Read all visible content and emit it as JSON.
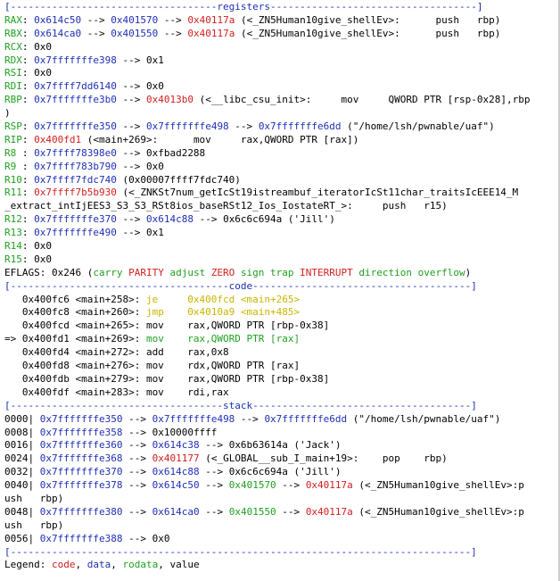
{
  "colors": {
    "code": "#1fa01f",
    "data": "#1f2fb4",
    "rodata": "#c8b400",
    "value": "#d21e1e",
    "text": "#000000"
  },
  "lines": [
    {
      "kind": "separator",
      "segs": [
        [
          "b",
          "[-----------------------------------"
        ],
        [
          "b",
          "registers"
        ],
        [
          "b",
          "-----------------------------------]"
        ]
      ]
    },
    {
      "kind": "register",
      "segs": [
        [
          "g",
          "RAX"
        ],
        [
          "k",
          ": "
        ],
        [
          "b",
          "0x614c50"
        ],
        [
          "k",
          " --> "
        ],
        [
          "b",
          "0x401570"
        ],
        [
          "k",
          " --> "
        ],
        [
          "r",
          "0x40117a"
        ],
        [
          "k",
          " (<_ZN5Human10give_shellEv>:      push   rbp)"
        ]
      ]
    },
    {
      "kind": "register",
      "segs": [
        [
          "g",
          "RBX"
        ],
        [
          "k",
          ": "
        ],
        [
          "b",
          "0x614ca0"
        ],
        [
          "k",
          " --> "
        ],
        [
          "b",
          "0x401550"
        ],
        [
          "k",
          " --> "
        ],
        [
          "r",
          "0x40117a"
        ],
        [
          "k",
          " (<_ZN5Human10give_shellEv>:      push   rbp)"
        ]
      ]
    },
    {
      "kind": "register",
      "segs": [
        [
          "g",
          "RCX"
        ],
        [
          "k",
          ": 0x0"
        ]
      ]
    },
    {
      "kind": "register",
      "segs": [
        [
          "g",
          "RDX"
        ],
        [
          "k",
          ": "
        ],
        [
          "b",
          "0x7fffffffe398"
        ],
        [
          "k",
          " --> 0x1"
        ]
      ]
    },
    {
      "kind": "register",
      "segs": [
        [
          "g",
          "RSI"
        ],
        [
          "k",
          ": 0x0"
        ]
      ]
    },
    {
      "kind": "register",
      "segs": [
        [
          "g",
          "RDI"
        ],
        [
          "k",
          ": "
        ],
        [
          "b",
          "0x7ffff7dd6140"
        ],
        [
          "k",
          " --> 0x0"
        ]
      ]
    },
    {
      "kind": "register",
      "segs": [
        [
          "g",
          "RBP"
        ],
        [
          "k",
          ": "
        ],
        [
          "b",
          "0x7fffffffe3b0"
        ],
        [
          "k",
          " --> "
        ],
        [
          "r",
          "0x4013b0"
        ],
        [
          "k",
          " (<__libc_csu_init>:     mov     QWORD PTR [rsp-0x28],rbp"
        ]
      ]
    },
    {
      "kind": "register",
      "segs": [
        [
          "k",
          ")"
        ]
      ]
    },
    {
      "kind": "register",
      "segs": [
        [
          "g",
          "RSP"
        ],
        [
          "k",
          ": "
        ],
        [
          "b",
          "0x7fffffffe350"
        ],
        [
          "k",
          " --> "
        ],
        [
          "b",
          "0x7fffffffe498"
        ],
        [
          "k",
          " --> "
        ],
        [
          "b",
          "0x7fffffffe6dd"
        ],
        [
          "k",
          " (\"/home/lsh/pwnable/uaf\")"
        ]
      ]
    },
    {
      "kind": "register",
      "segs": [
        [
          "g",
          "RIP"
        ],
        [
          "k",
          ": "
        ],
        [
          "r",
          "0x400fd1"
        ],
        [
          "k",
          " (<main+269>:      mov     rax,QWORD PTR [rax])"
        ]
      ]
    },
    {
      "kind": "register",
      "segs": [
        [
          "g",
          "R8 "
        ],
        [
          "k",
          ": "
        ],
        [
          "b",
          "0x7ffff78398e0"
        ],
        [
          "k",
          " --> 0xfbad2288"
        ]
      ]
    },
    {
      "kind": "register",
      "segs": [
        [
          "g",
          "R9 "
        ],
        [
          "k",
          ": "
        ],
        [
          "b",
          "0x7ffff783b790"
        ],
        [
          "k",
          " --> 0x0"
        ]
      ]
    },
    {
      "kind": "register",
      "segs": [
        [
          "g",
          "R10"
        ],
        [
          "k",
          ": "
        ],
        [
          "b",
          "0x7ffff7fdc740"
        ],
        [
          "k",
          " (0x00007ffff7fdc740)"
        ]
      ]
    },
    {
      "kind": "register",
      "segs": [
        [
          "g",
          "R11"
        ],
        [
          "k",
          ": "
        ],
        [
          "r",
          "0x7ffff7b5b930"
        ],
        [
          "k",
          " (<_ZNKSt7num_getIcSt19istreambuf_iteratorIcSt11char_traitsIcEEE14_M"
        ]
      ]
    },
    {
      "kind": "register",
      "segs": [
        [
          "k",
          "_extract_intIjEES3_S3_S3_RSt8ios_baseRSt12_Ios_IostateRT_>:     push   r15)"
        ]
      ]
    },
    {
      "kind": "register",
      "segs": [
        [
          "g",
          "R12"
        ],
        [
          "k",
          ": "
        ],
        [
          "b",
          "0x7fffffffe370"
        ],
        [
          "k",
          " --> "
        ],
        [
          "b",
          "0x614c88"
        ],
        [
          "k",
          " --> 0x6c6c694a ('Jill')"
        ]
      ]
    },
    {
      "kind": "register",
      "segs": [
        [
          "g",
          "R13"
        ],
        [
          "k",
          ": "
        ],
        [
          "b",
          "0x7fffffffe490"
        ],
        [
          "k",
          " --> 0x1"
        ]
      ]
    },
    {
      "kind": "register",
      "segs": [
        [
          "g",
          "R14"
        ],
        [
          "k",
          ": 0x0"
        ]
      ]
    },
    {
      "kind": "register",
      "segs": [
        [
          "g",
          "R15"
        ],
        [
          "k",
          ": 0x0"
        ]
      ]
    },
    {
      "kind": "flags",
      "segs": [
        [
          "k",
          "EFLAGS: 0x246 ("
        ],
        [
          "g",
          "carry "
        ],
        [
          "r",
          "PARITY "
        ],
        [
          "g",
          "adjust "
        ],
        [
          "r",
          "ZERO "
        ],
        [
          "g",
          "sign trap "
        ],
        [
          "r",
          "INTERRUPT "
        ],
        [
          "g",
          "direction overflow"
        ],
        [
          "k",
          ")"
        ]
      ]
    },
    {
      "kind": "separator",
      "segs": [
        [
          "b",
          "[-------------------------------------"
        ],
        [
          "b",
          "code"
        ],
        [
          "b",
          "-------------------------------------]"
        ]
      ]
    },
    {
      "kind": "code",
      "segs": [
        [
          "k",
          "   0x400fc6 <main+258>: "
        ],
        [
          "y",
          "je     0x400fcd <main+265>"
        ]
      ]
    },
    {
      "kind": "code",
      "segs": [
        [
          "k",
          "   0x400fc8 <main+260>: "
        ],
        [
          "y",
          "jmp    0x4010a9 <main+485>"
        ]
      ]
    },
    {
      "kind": "code",
      "segs": [
        [
          "k",
          "   0x400fcd <main+265>: mov    rax,QWORD PTR [rbp-0x38]"
        ]
      ]
    },
    {
      "kind": "code",
      "segs": [
        [
          "k",
          "=> 0x400fd1 <main+269>: "
        ],
        [
          "g",
          "mov    rax,QWORD PTR [rax]"
        ]
      ]
    },
    {
      "kind": "code",
      "segs": [
        [
          "k",
          "   0x400fd4 <main+272>: add    rax,0x8"
        ]
      ]
    },
    {
      "kind": "code",
      "segs": [
        [
          "k",
          "   0x400fd8 <main+276>: mov    rdx,QWORD PTR [rax]"
        ]
      ]
    },
    {
      "kind": "code",
      "segs": [
        [
          "k",
          "   0x400fdb <main+279>: mov    rax,QWORD PTR [rbp-0x38]"
        ]
      ]
    },
    {
      "kind": "code",
      "segs": [
        [
          "k",
          "   0x400fdf <main+283>: mov    rdi,rax"
        ]
      ]
    },
    {
      "kind": "separator",
      "segs": [
        [
          "b",
          "[------------------------------------"
        ],
        [
          "b",
          "stack"
        ],
        [
          "b",
          "-------------------------------------]"
        ]
      ]
    },
    {
      "kind": "stack",
      "segs": [
        [
          "k",
          "0000| "
        ],
        [
          "b",
          "0x7fffffffe350"
        ],
        [
          "k",
          " --> "
        ],
        [
          "b",
          "0x7fffffffe498"
        ],
        [
          "k",
          " --> "
        ],
        [
          "b",
          "0x7fffffffe6dd"
        ],
        [
          "k",
          " (\"/home/lsh/pwnable/uaf\")"
        ]
      ]
    },
    {
      "kind": "stack",
      "segs": [
        [
          "k",
          "0008| "
        ],
        [
          "b",
          "0x7fffffffe358"
        ],
        [
          "k",
          " --> 0x10000ffff"
        ]
      ]
    },
    {
      "kind": "stack",
      "segs": [
        [
          "k",
          "0016| "
        ],
        [
          "b",
          "0x7fffffffe360"
        ],
        [
          "k",
          " --> "
        ],
        [
          "b",
          "0x614c38"
        ],
        [
          "k",
          " --> 0x6b63614a ('Jack')"
        ]
      ]
    },
    {
      "kind": "stack",
      "segs": [
        [
          "k",
          "0024| "
        ],
        [
          "b",
          "0x7fffffffe368"
        ],
        [
          "k",
          " --> "
        ],
        [
          "r",
          "0x401177"
        ],
        [
          "k",
          " (<_GLOBAL__sub_I_main+19>:    pop    rbp)"
        ]
      ]
    },
    {
      "kind": "stack",
      "segs": [
        [
          "k",
          "0032| "
        ],
        [
          "b",
          "0x7fffffffe370"
        ],
        [
          "k",
          " --> "
        ],
        [
          "b",
          "0x614c88"
        ],
        [
          "k",
          " --> 0x6c6c694a ('Jill')"
        ]
      ]
    },
    {
      "kind": "stack",
      "segs": [
        [
          "k",
          "0040| "
        ],
        [
          "b",
          "0x7fffffffe378"
        ],
        [
          "k",
          " --> "
        ],
        [
          "b",
          "0x614c50"
        ],
        [
          "k",
          " --> "
        ],
        [
          "g",
          "0x401570"
        ],
        [
          "k",
          " --> "
        ],
        [
          "r",
          "0x40117a"
        ],
        [
          "k",
          " (<_ZN5Human10give_shellEv>:p"
        ]
      ]
    },
    {
      "kind": "stack",
      "segs": [
        [
          "k",
          "ush   rbp)"
        ]
      ]
    },
    {
      "kind": "stack",
      "segs": [
        [
          "k",
          "0048| "
        ],
        [
          "b",
          "0x7fffffffe380"
        ],
        [
          "k",
          " --> "
        ],
        [
          "b",
          "0x614ca0"
        ],
        [
          "k",
          " --> "
        ],
        [
          "g",
          "0x401550"
        ],
        [
          "k",
          " --> "
        ],
        [
          "r",
          "0x40117a"
        ],
        [
          "k",
          " (<_ZN5Human10give_shellEv>:p"
        ]
      ]
    },
    {
      "kind": "stack",
      "segs": [
        [
          "k",
          "ush   rbp)"
        ]
      ]
    },
    {
      "kind": "stack",
      "segs": [
        [
          "k",
          "0056| "
        ],
        [
          "b",
          "0x7fffffffe388"
        ],
        [
          "k",
          " --> 0x0"
        ]
      ]
    },
    {
      "kind": "separator",
      "segs": [
        [
          "b",
          "[------------------------------------------------------------------------------]"
        ]
      ]
    },
    {
      "kind": "legend",
      "segs": [
        [
          "k",
          "Legend: "
        ],
        [
          "r",
          "code"
        ],
        [
          "k",
          ", "
        ],
        [
          "b",
          "data"
        ],
        [
          "k",
          ", "
        ],
        [
          "g",
          "rodata"
        ],
        [
          "k",
          ", value"
        ]
      ]
    }
  ]
}
